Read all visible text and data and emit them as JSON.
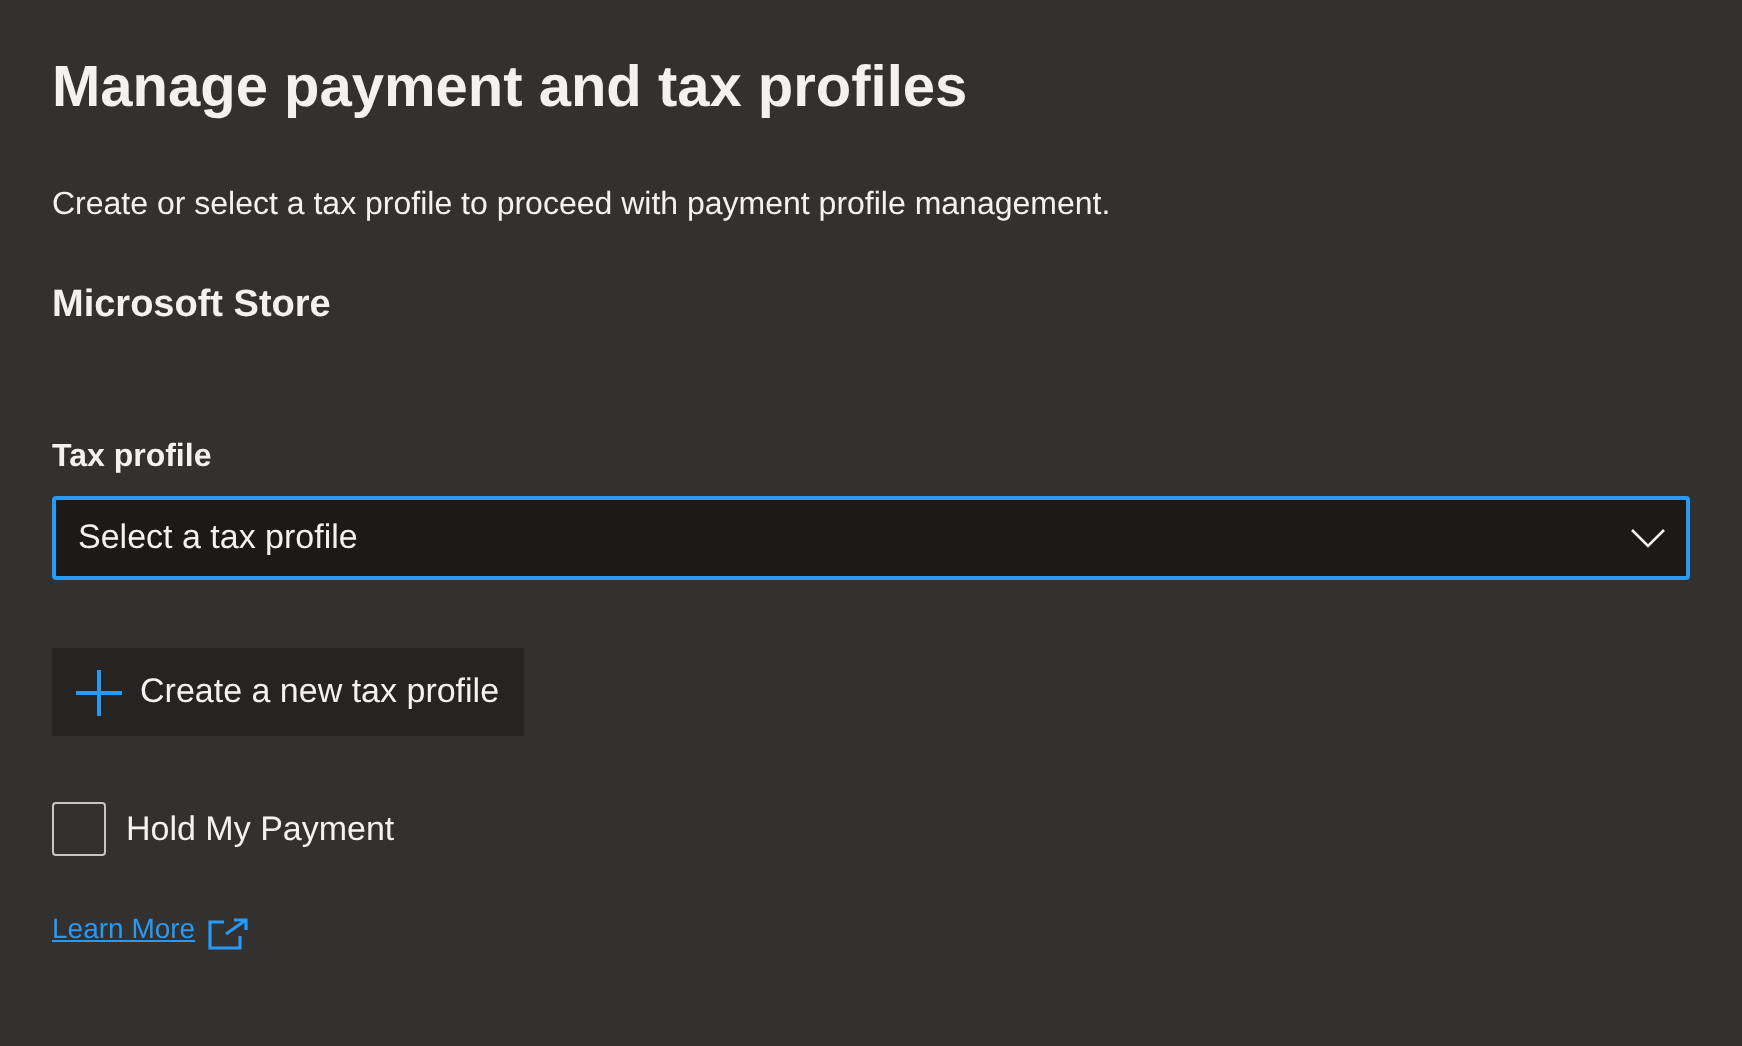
{
  "title": "Manage payment and tax profiles",
  "description": "Create or select a tax profile to proceed with payment profile management.",
  "section": "Microsoft Store",
  "tax_profile": {
    "label": "Tax profile",
    "placeholder": "Select a tax profile",
    "focused": true
  },
  "create_button": {
    "label": "Create a new tax profile"
  },
  "hold_payment": {
    "label": "Hold My Payment",
    "checked": false
  },
  "link": {
    "label": "Learn More"
  }
}
